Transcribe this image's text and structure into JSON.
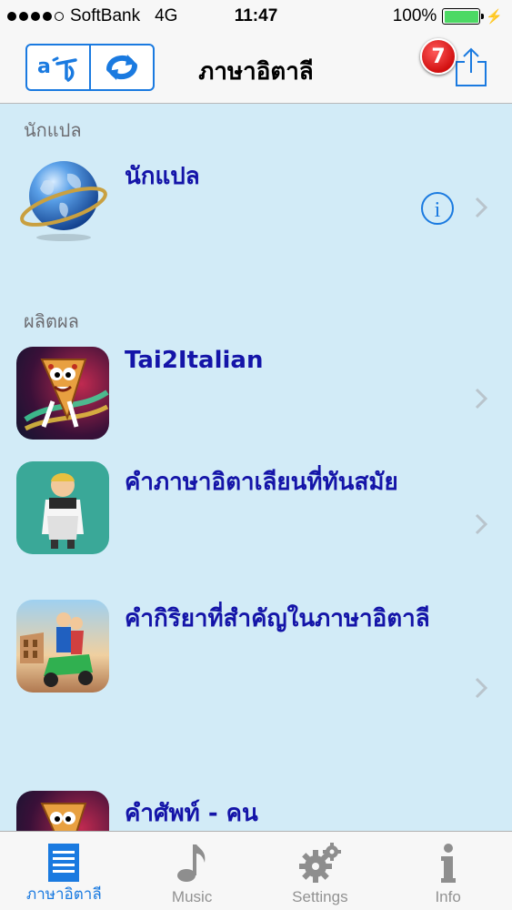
{
  "status_bar": {
    "carrier": "SoftBank",
    "network": "4G",
    "time": "11:47",
    "battery": "100%",
    "signal_bars": 4
  },
  "nav": {
    "title": "ภาษาอิตาลี",
    "badge_count": "7"
  },
  "sections": [
    {
      "header": "นักแปล"
    },
    {
      "header": "ผลิตผล"
    }
  ],
  "rows": [
    {
      "title": "นักแปล",
      "icon": "globe-icon"
    },
    {
      "title": "Tai2Italian",
      "icon": "pizza-character-icon"
    },
    {
      "title": "คำภาษาอิตาเลียนที่ทันสมัย",
      "icon": "chef-icon"
    },
    {
      "title": "คำกิริยาที่สำคัญในภาษาอิตาลี",
      "icon": "colosseum-scooter-icon"
    },
    {
      "title": "คำศัพท์ - คน",
      "icon": "pizza-character-icon"
    }
  ],
  "tabs": [
    {
      "label": "ภาษาอิตาลี",
      "icon": "list-icon",
      "active": true
    },
    {
      "label": "Music",
      "icon": "music-note-icon",
      "active": false
    },
    {
      "label": "Settings",
      "icon": "gear-icon",
      "active": false
    },
    {
      "label": "Info",
      "icon": "info-icon",
      "active": false
    }
  ],
  "colors": {
    "accent": "#1a7ae0",
    "row_title": "#1414a8",
    "background": "#d2ebf7",
    "badge": "#d11010"
  }
}
